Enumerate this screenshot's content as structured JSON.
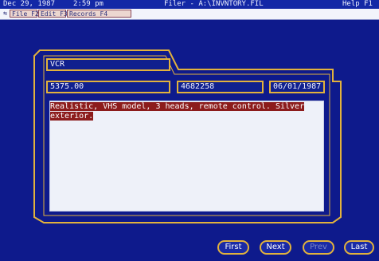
{
  "statusbar": {
    "date": "Dec 29, 1987",
    "time": "2:59 pm",
    "title": "Filer - A:\\INVNTORY.FIL",
    "help": "Help F1"
  },
  "menubar": {
    "icon": "⇆",
    "file": "File F2",
    "edit": "Edit F3",
    "records": "Records F4"
  },
  "record": {
    "item": "VCR",
    "price": "5375.00",
    "code": "4682258",
    "date": "06/01/1987",
    "notes": "Realistic, VHS model, 3 heads, remote control. Silver exterior."
  },
  "nav": {
    "first": "First",
    "next": "Next",
    "prev": "Prev",
    "last": "Last"
  },
  "colors": {
    "background": "#0e1a8c",
    "border": "#e2b23c",
    "highlight": "#8c1c1c"
  }
}
